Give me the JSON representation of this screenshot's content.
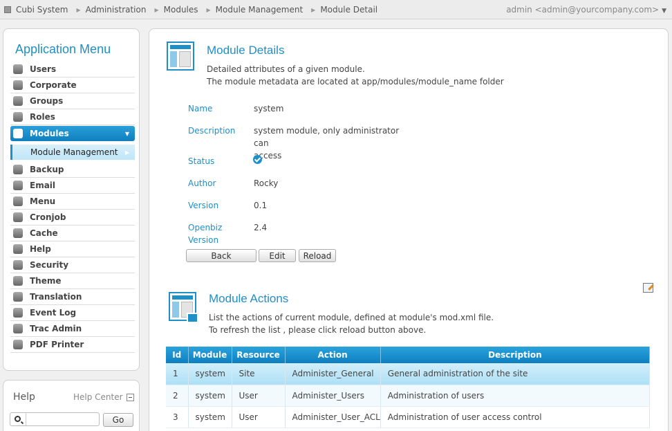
{
  "breadcrumb": {
    "items": [
      "Cubi System",
      "Administration",
      "Modules",
      "Module Management",
      "Module Detail"
    ]
  },
  "user": {
    "label": "admin <admin@yourcompany.com>"
  },
  "menu": {
    "title": "Application Menu",
    "items": [
      {
        "label": "Users",
        "icon": "users-icon"
      },
      {
        "label": "Corporate",
        "icon": "home-icon"
      },
      {
        "label": "Groups",
        "icon": "groups-icon"
      },
      {
        "label": "Roles",
        "icon": "key-icon"
      },
      {
        "label": "Modules",
        "icon": "modules-icon",
        "active": true
      },
      {
        "label": "Backup",
        "icon": "backup-icon"
      },
      {
        "label": "Email",
        "icon": "email-icon"
      },
      {
        "label": "Menu",
        "icon": "menu-icon"
      },
      {
        "label": "Cronjob",
        "icon": "clock-icon"
      },
      {
        "label": "Cache",
        "icon": "cache-icon"
      },
      {
        "label": "Help",
        "icon": "help-icon"
      },
      {
        "label": "Security",
        "icon": "shield-icon"
      },
      {
        "label": "Theme",
        "icon": "monitor-icon"
      },
      {
        "label": "Translation",
        "icon": "translation-icon"
      },
      {
        "label": "Event Log",
        "icon": "log-icon"
      },
      {
        "label": "Trac Admin",
        "icon": "trac-icon"
      },
      {
        "label": "PDF Printer",
        "icon": "printer-icon"
      }
    ],
    "submenu_label": "Module Management"
  },
  "help": {
    "title": "Help",
    "center_label": "Help Center",
    "search_value": "",
    "go_label": "Go"
  },
  "details": {
    "title": "Module Details",
    "desc_line1": "Detailed attributes of a given module.",
    "desc_line2": "The module metadata are located at app/modules/module_name folder",
    "fields": {
      "name_label": "Name",
      "name_value": "system",
      "description_label": "Description",
      "description_value_line1": "system module, only administrator can",
      "description_value_line2": "access",
      "status_label": "Status",
      "author_label": "Author",
      "author_value": "Rocky",
      "version_label": "Version",
      "version_value": "0.1",
      "openbiz_label_line1": "Openbiz",
      "openbiz_label_line2": "Version",
      "openbiz_value": "2.4"
    },
    "buttons": {
      "back": "Back",
      "edit": "Edit",
      "reload": "Reload"
    }
  },
  "actions": {
    "title": "Module Actions",
    "desc_line1": "List the actions of current module, defined at module's mod.xml file.",
    "desc_line2": "To refresh the list , please click reload button above.",
    "columns": [
      "Id",
      "Module",
      "Resource",
      "Action",
      "Description"
    ],
    "rows": [
      {
        "id": "1",
        "module": "system",
        "resource": "Site",
        "action": "Administer_General",
        "description": "General administration of the site"
      },
      {
        "id": "2",
        "module": "system",
        "resource": "User",
        "action": "Administer_Users",
        "description": "Administration of users"
      },
      {
        "id": "3",
        "module": "system",
        "resource": "User",
        "action": "Administer_User_ACL",
        "description": "Administration of user access control"
      }
    ]
  }
}
